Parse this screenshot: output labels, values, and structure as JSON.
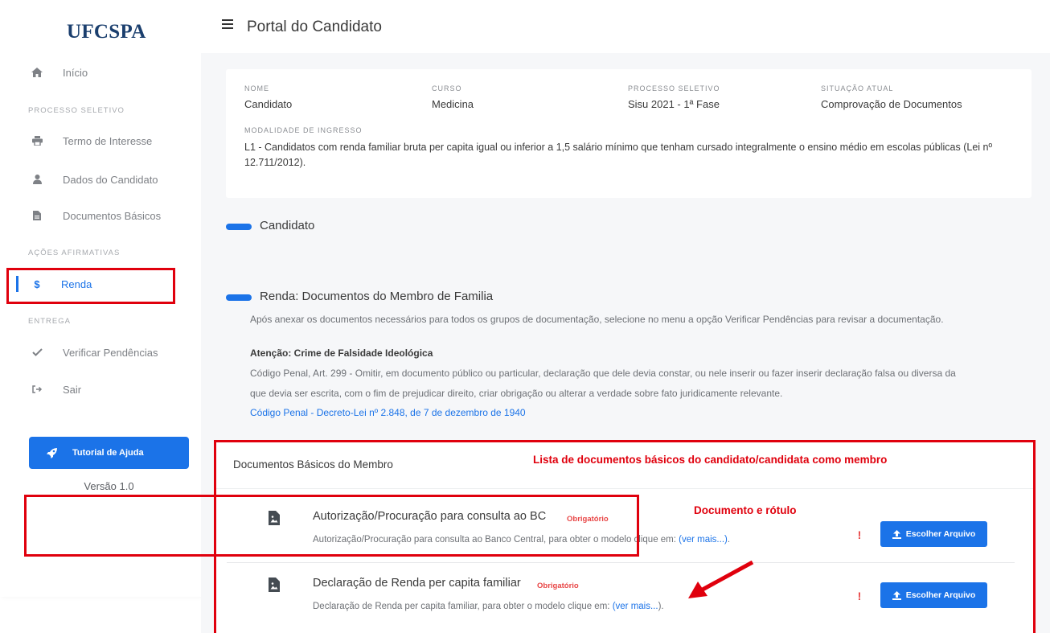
{
  "app": {
    "logo_text": "UFCSPA",
    "page_title": "Portal do Candidato",
    "brand_color": "#1b73e8",
    "annotation_color": "#e0000d"
  },
  "sidebar": {
    "home_label": "Início",
    "section_processo": "PROCESSO SELETIVO",
    "termo_label": "Termo de Interesse",
    "dados_label": "Dados do Candidato",
    "docs_label": "Documentos Básicos",
    "section_acoes": "AÇÕES AFIRMATIVAS",
    "renda_icon": "$",
    "renda_label": "Renda",
    "section_entrega": "ENTREGA",
    "verificar_label": "Verificar Pendências",
    "sair_label": "Sair",
    "help_label": "Tutorial de Ajuda",
    "version": "Versão 1.0"
  },
  "info": {
    "nome_label": "NOME",
    "nome_value": "Candidato",
    "curso_label": "CURSO",
    "curso_value": "Medicina",
    "processo_label": "PROCESSO SELETIVO",
    "processo_value": "Sisu 2021 - 1ª Fase",
    "situacao_label": "SITUAÇÃO ATUAL",
    "situacao_value": "Comprovação de Documentos",
    "modalidade_label": "MODALIDADE DE INGRESSO",
    "modalidade_value": "L1 - Candidatos com renda familiar bruta per capita igual ou inferior a 1,5 salário mínimo que tenham cursado integralmente o ensino médio em escolas públicas (Lei nº 12.711/2012)."
  },
  "sections": {
    "candidato_title": "Candidato",
    "renda_title": "Renda: Documentos do Membro de Familia",
    "renda_intro": "Após anexar os documentos necessários para todos os grupos de documentação, selecione no menu a opção Verificar Pendências para revisar a documentação.",
    "atencao_title": "Atenção: Crime de Falsidade Ideológica",
    "atencao_line1": "Código Penal, Art. 299 - Omitir, em documento público ou particular, declaração que dele devia constar, ou nele inserir ou fazer inserir declaração falsa ou diversa da",
    "atencao_line2": "que devia ser escrita, com o fim de prejudicar direito, criar obrigação ou alterar a verdade sobre fato juridicamente relevante.",
    "atencao_link": "Código Penal - Decreto-Lei nº 2.848, de 7 de dezembro de 1940"
  },
  "docs_panel": {
    "title": "Documentos Básicos do Membro",
    "annotation": "Lista de documentos básicos do candidato/candidata como membro",
    "doc_annotation": "Documento e rótulo",
    "items": [
      {
        "name": "Autorização/Procuração para consulta ao BC",
        "badge": "Obrigatório",
        "desc": "Autorização/Procuração para consulta ao Banco Central, para obter o modelo clique em: ",
        "link": "(ver mais...)",
        "after": ".",
        "status_icon": "!",
        "button": "Escolher Arquivo"
      },
      {
        "name": "Declaração de Renda per capita familiar",
        "badge": "Obrigatório",
        "desc": "Declaração de Renda per capita familiar, para obter o modelo clique em: ",
        "link": "(ver mais...",
        "after": ").",
        "status_icon": "!",
        "button": "Escolher Arquivo"
      }
    ]
  }
}
